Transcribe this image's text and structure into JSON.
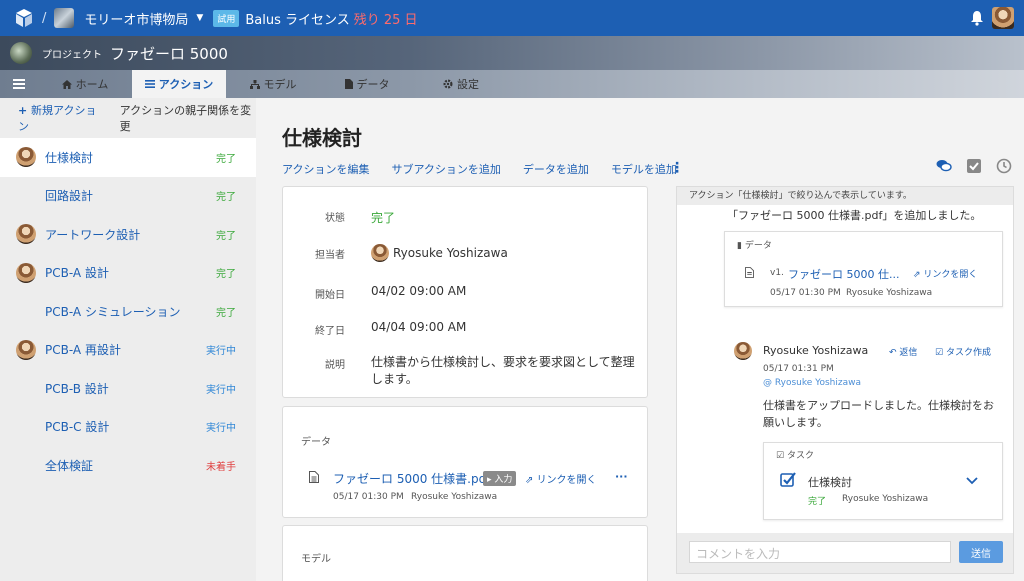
{
  "topbar": {
    "org_name": "モリーオ市博物局",
    "trial_badge": "試用",
    "license_text": "Balus ライセンス",
    "remaining": "残り 25 日",
    "slash": "/"
  },
  "project": {
    "label": "プロジェクト",
    "name": "ファゼーロ 5000"
  },
  "nav": {
    "tabs": [
      {
        "label": "ホーム"
      },
      {
        "label": "アクション"
      },
      {
        "label": "モデル"
      },
      {
        "label": "データ"
      },
      {
        "label": "設定"
      }
    ]
  },
  "sidebar": {
    "new_action": "新規アクション",
    "reparent": "アクションの親子関係を変更",
    "items": [
      {
        "label": "仕様検討",
        "status": "完了",
        "avatar": true
      },
      {
        "label": "回路設計",
        "status": "完了",
        "avatar": false
      },
      {
        "label": "アートワーク設計",
        "status": "完了",
        "avatar": true
      },
      {
        "label": "PCB-A 設計",
        "status": "完了",
        "avatar": true
      },
      {
        "label": "PCB-A シミュレーション",
        "status": "完了",
        "avatar": false
      },
      {
        "label": "PCB-A 再設計",
        "status": "実行中",
        "avatar": true
      },
      {
        "label": "PCB-B 設計",
        "status": "実行中",
        "avatar": false
      },
      {
        "label": "PCB-C 設計",
        "status": "実行中",
        "avatar": false
      },
      {
        "label": "全体検証",
        "status": "未着手",
        "avatar": false
      }
    ]
  },
  "main": {
    "title": "仕様検討",
    "subnav": [
      "アクションを編集",
      "サブアクションを追加",
      "データを追加",
      "モデルを追加"
    ],
    "fields": {
      "status_label": "状態",
      "status_value": "完了",
      "assignee_label": "担当者",
      "assignee_value": "Ryosuke Yoshizawa",
      "start_label": "開始日",
      "start_value": "04/02 09:00 AM",
      "end_label": "終了日",
      "end_value": "04/04 09:00 AM",
      "desc_label": "説明",
      "desc_value": "仕様書から仕様検討し、要求を要求図として整理します。"
    },
    "data_card": {
      "heading": "データ",
      "file_name": "ファゼーロ 5000 仕様書.pdf",
      "input_badge": "入力",
      "open_link": "リンクを開く",
      "more": "···",
      "meta_time": "05/17 01:30 PM",
      "meta_user": "Ryosuke Yoshizawa"
    },
    "model_card": {
      "heading": "モデル"
    }
  },
  "activity": {
    "notice": "アクション「仕様検討」で絞り込んで表示しています。",
    "added_text": "「ファゼーロ 5000 仕様書.pdf」を追加しました。",
    "data_box": {
      "heading": "データ",
      "version": "v1.",
      "file_name": "ファゼーロ 5000 仕...",
      "open_link": "リンクを開く",
      "meta_time": "05/17 01:30 PM",
      "meta_user": "Ryosuke Yoshizawa"
    },
    "comment": {
      "author": "Ryosuke Yoshizawa",
      "reply": "返信",
      "create_task": "タスク作成",
      "time": "05/17 01:31 PM",
      "mention": "@ Ryosuke Yoshizawa",
      "body": "仕様書をアップロードしました。仕様検討をお願いします。"
    },
    "task_box": {
      "heading": "タスク",
      "name": "仕様検討",
      "status": "完了",
      "user": "Ryosuke Yoshizawa"
    },
    "comment_placeholder": "コメントを入力",
    "send": "送信"
  },
  "colors": {
    "brand": "#1d5fb3",
    "done": "#3aa83a",
    "in_progress": "#2f86d6",
    "not_started": "#e04040"
  }
}
